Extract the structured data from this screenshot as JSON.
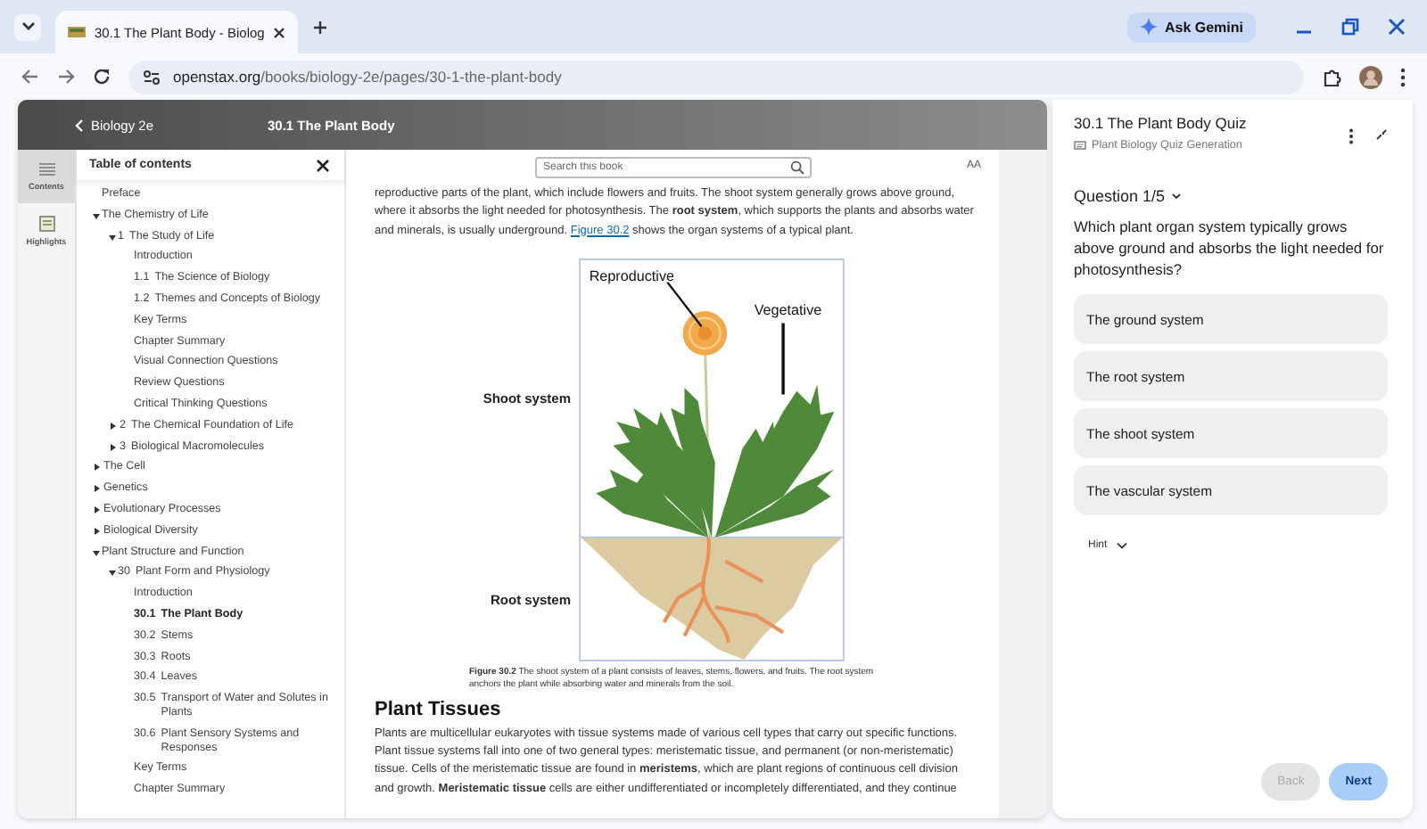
{
  "browser": {
    "tab": {
      "title": "30.1 The Plant Body - Biolog"
    },
    "gemini_button": "Ask Gemini",
    "url": {
      "domain": "openstax.org",
      "path": "/books/biology-2e/pages/30-1-the-plant-body"
    }
  },
  "reader": {
    "back_link": "Biology 2e",
    "page_title": "30.1 The Plant Body",
    "rail": [
      {
        "label": "Contents",
        "kind": "contents",
        "selected": true
      },
      {
        "label": "Highlights",
        "kind": "highlights",
        "selected": false
      }
    ],
    "toc": {
      "title": "Table of contents",
      "items": [
        {
          "kind": "page",
          "title": "Preface",
          "selected": false
        },
        {
          "kind": "folder",
          "title": "The Chemistry of Life",
          "expanded": true,
          "selected": false,
          "children": [
            {
              "kind": "folder",
              "number": "1",
              "title": "The Study of Life",
              "expanded": true,
              "selected": false,
              "children": [
                {
                  "kind": "page",
                  "title": "Introduction",
                  "selected": false
                },
                {
                  "kind": "page",
                  "number": "1.1",
                  "title": "The Science of Biology",
                  "selected": false
                },
                {
                  "kind": "page",
                  "number": "1.2",
                  "title": "Themes and Concepts of Biology",
                  "selected": false
                },
                {
                  "kind": "page",
                  "title": "Key Terms",
                  "selected": false
                },
                {
                  "kind": "page",
                  "title": "Chapter Summary",
                  "selected": false
                },
                {
                  "kind": "page",
                  "title": "Visual Connection Questions",
                  "selected": false
                },
                {
                  "kind": "page",
                  "title": "Review Questions",
                  "selected": false
                },
                {
                  "kind": "page",
                  "title": "Critical Thinking Questions",
                  "selected": false
                }
              ]
            },
            {
              "kind": "folder",
              "number": "2",
              "title": "The Chemical Foundation of Life",
              "expanded": false,
              "selected": false
            },
            {
              "kind": "folder",
              "number": "3",
              "title": "Biological Macromolecules",
              "expanded": false,
              "selected": false
            }
          ]
        },
        {
          "kind": "folder",
          "title": "The Cell",
          "expanded": false,
          "selected": false
        },
        {
          "kind": "folder",
          "title": "Genetics",
          "expanded": false,
          "selected": false
        },
        {
          "kind": "folder",
          "title": "Evolutionary Processes",
          "expanded": false,
          "selected": false
        },
        {
          "kind": "folder",
          "title": "Biological Diversity",
          "expanded": false,
          "selected": false
        },
        {
          "kind": "folder",
          "title": "Plant Structure and Function",
          "expanded": true,
          "selected": false,
          "children": [
            {
              "kind": "folder",
              "number": "30",
              "title": "Plant Form and Physiology",
              "expanded": true,
              "selected": false,
              "children": [
                {
                  "kind": "page",
                  "title": "Introduction",
                  "selected": false
                },
                {
                  "kind": "page",
                  "number": "30.1",
                  "title": "The Plant Body",
                  "selected": true
                },
                {
                  "kind": "page",
                  "number": "30.2",
                  "title": "Stems",
                  "selected": false
                },
                {
                  "kind": "page",
                  "number": "30.3",
                  "title": "Roots",
                  "selected": false
                },
                {
                  "kind": "page",
                  "number": "30.4",
                  "title": "Leaves",
                  "selected": false
                },
                {
                  "kind": "page",
                  "number": "30.5",
                  "title": "Transport of Water and Solutes in Plants",
                  "selected": false
                },
                {
                  "kind": "page",
                  "number": "30.6",
                  "title": "Plant Sensory Systems and Responses",
                  "selected": false
                },
                {
                  "kind": "page",
                  "title": "Key Terms",
                  "selected": false
                },
                {
                  "kind": "page",
                  "title": "Chapter Summary",
                  "selected": false
                }
              ]
            }
          ]
        }
      ]
    },
    "search": {
      "placeholder": "Search this book"
    },
    "text_size_button": "AA",
    "article": {
      "intro_before": "reproductive parts of the plant, which include flowers and fruits. The shoot system generally grows above ground, where it absorbs the light needed for photosynthesis. The **root system**, which supports the plants and absorbs water and minerals, is usually underground.",
      "intro_link": "Figure 30.2",
      "intro_after": "shows the organ systems of a typical plant.",
      "figure": {
        "reproductive_label": "Reproductive",
        "vegetative_label": "Vegetative",
        "shoot_label": "Shoot system",
        "root_label": "Root system"
      },
      "caption": "**Figure 30.2** The shoot system of a plant consists of leaves, stems, flowers, and fruits. The root system anchors the plant while absorbing water and minerals from the soil.",
      "heading": "Plant Tissues",
      "paragraph": "Plants are multicellular eukaryotes with tissue systems made of various cell types that carry out specific functions. Plant tissue systems fall into one of two general types: meristematic tissue, and permanent (or non-meristematic) tissue. Cells of the meristematic tissue are found in **meristems**, which are plant regions of continuous cell division and growth. **Meristematic tissue** cells are either undifferentiated or incompletely differentiated, and they continue"
    }
  },
  "quiz": {
    "title": "30.1 The Plant Body Quiz",
    "subtitle": "Plant Biology Quiz Generation",
    "question_label": "Question 1/5",
    "question": "Which plant organ system typically grows above ground and absorbs the light needed for photosynthesis?",
    "options": [
      {
        "text": "The ground system",
        "selected": false
      },
      {
        "text": "The root system",
        "selected": false
      },
      {
        "text": "The shoot system",
        "selected": false
      },
      {
        "text": "The vascular system",
        "selected": false
      }
    ],
    "hint": {
      "label": "Hint",
      "expanded": false
    },
    "buttons": [
      {
        "label": "Back",
        "kind": "back",
        "disabled": true
      },
      {
        "label": "Next",
        "kind": "next",
        "disabled": false
      }
    ]
  }
}
